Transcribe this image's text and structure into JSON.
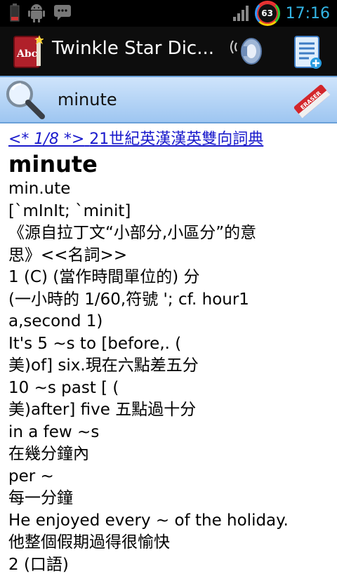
{
  "status_bar": {
    "time": "17:16",
    "battery_level": "63",
    "icons": [
      "battery-low-icon",
      "android-debug-icon",
      "message-icon",
      "signal-icon"
    ]
  },
  "action_bar": {
    "title": "Twinkle Star Dic...",
    "app_icon": "abc-book-icon",
    "speak_icon": "speaker-icon",
    "notes_icon": "notes-add-icon"
  },
  "search": {
    "query": "minute",
    "search_icon": "magnifier-icon",
    "clear_icon": "eraser-icon",
    "eraser_label": "ERASER"
  },
  "entry": {
    "nav": "<* 1/8 *>",
    "dictionary_name": "21世紀英漢漢英雙向詞典",
    "headword": "minute",
    "lines": [
      "min.ute",
      "[`mInIt; `minit]",
      "《源自拉丁文“小部分,小區分”的意",
      "思》<<名詞>>",
      "1 (C) (當作時間單位的) 分",
      "(一小時的 1/60,符號 '; cf. hour1",
      "a,second 1)",
      "It's 5 ~s to [before,. (",
      "美)of] six.現在六點差五分",
      "10 ~s past [ (",
      "美)after] five 五點過十分",
      "in a few ~s",
      "在幾分鐘內",
      "per ~",
      "每一分鐘",
      "He enjoyed every ~ of the holiday.",
      "他整個假期過得很愉快",
      "2 (口語)"
    ]
  },
  "colors": {
    "status_time": "#33b5e5",
    "link": "#1a1acc",
    "search_bar": "#9ec6f1"
  }
}
